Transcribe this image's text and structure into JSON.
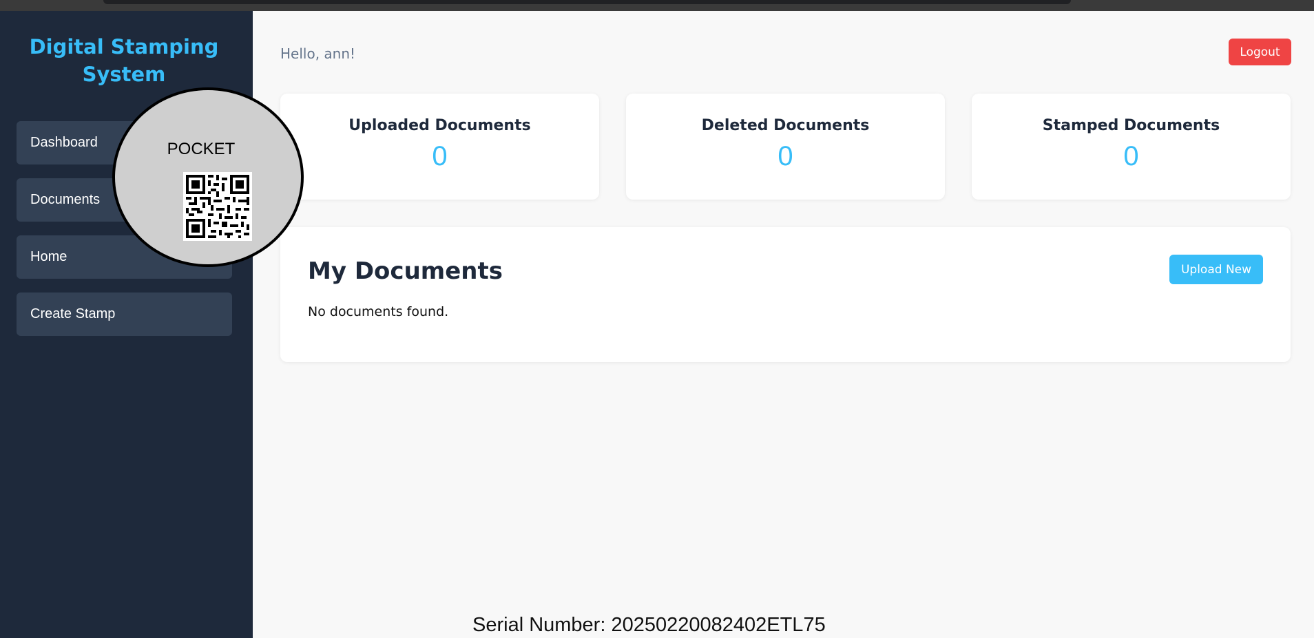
{
  "app": {
    "title": "Digital Stamping System"
  },
  "sidebar": {
    "items": [
      {
        "label": "Dashboard"
      },
      {
        "label": "Documents"
      },
      {
        "label": "Home"
      },
      {
        "label": "Create Stamp"
      }
    ]
  },
  "header": {
    "greeting": "Hello, ann!",
    "logout_label": "Logout"
  },
  "stats": [
    {
      "title": "Uploaded Documents",
      "value": "0"
    },
    {
      "title": "Deleted Documents",
      "value": "0"
    },
    {
      "title": "Stamped Documents",
      "value": "0"
    }
  ],
  "documents": {
    "title": "My Documents",
    "upload_label": "Upload New",
    "empty_message": "No documents found."
  },
  "stamp": {
    "label": "POCKET",
    "serial": "Serial Number: 20250220082402ETL75",
    "icon": "qr-code-icon"
  },
  "colors": {
    "sidebar_bg": "#1e293b",
    "nav_item_bg": "#334155",
    "accent": "#38bdf8",
    "danger": "#ef4444"
  }
}
